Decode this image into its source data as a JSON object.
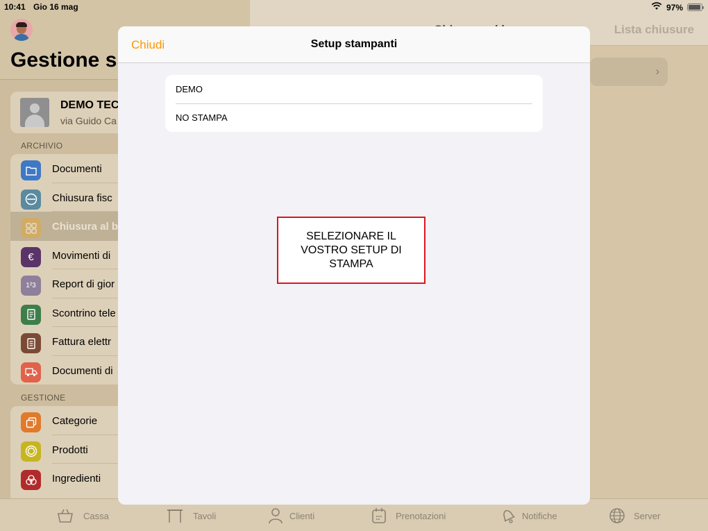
{
  "status_bar": {
    "time": "10:41",
    "date": "Gio 16 mag",
    "battery": "97%",
    "battery_level": 0.97
  },
  "master": {
    "title": "Gestione s",
    "profile": {
      "name": "DEMO TEC",
      "address": "via Guido Ca"
    },
    "sections": [
      {
        "header": "ARCHIVIO",
        "items": [
          {
            "label": "Documenti",
            "icon": "folder-icon",
            "color": "#3f78c5"
          },
          {
            "label": "Chiusura fisc",
            "icon": "minus-circle-icon",
            "color": "#5a8aa0"
          },
          {
            "label": "Chiusura al b",
            "icon": "grid-icon",
            "color": "#e3a93e",
            "selected": true
          },
          {
            "label": "Movimenti di",
            "icon": "euro-icon",
            "color": "#5a3468"
          },
          {
            "label": "Report di gior",
            "icon": "numbers-icon",
            "color": "#8e7f9a"
          },
          {
            "label": "Scontrino tele",
            "icon": "receipt-icon",
            "color": "#3f7d4b"
          },
          {
            "label": "Fattura elettr",
            "icon": "invoice-icon",
            "color": "#7b4a35"
          },
          {
            "label": "Documenti di",
            "icon": "truck-icon",
            "color": "#e0624a"
          }
        ]
      },
      {
        "header": "GESTIONE",
        "items": [
          {
            "label": "Categorie",
            "icon": "copy-icon",
            "color": "#e07a2c"
          },
          {
            "label": "Prodotti",
            "icon": "circle-icon",
            "color": "#c6b520"
          },
          {
            "label": "Ingredienti",
            "icon": "rings-icon",
            "color": "#b22b2b"
          }
        ]
      }
    ]
  },
  "detail": {
    "title_partial": "Chiusura al bar",
    "lista_button": "Lista chiusure"
  },
  "modal": {
    "close_label": "Chiudi",
    "title": "Setup stampanti",
    "printers": [
      "DEMO",
      "NO STAMPA"
    ],
    "instructions": "SELEZIONARE IL VOSTRO SETUP DI STAMPA",
    "accent_color": "#ff9500",
    "highlight_color": "#e1121b"
  },
  "tabbar": {
    "tabs": [
      {
        "label": "Cassa",
        "icon": "basket-icon"
      },
      {
        "label": "Tavoli",
        "icon": "table-icon"
      },
      {
        "label": "Clienti",
        "icon": "person-icon"
      },
      {
        "label": "Prenotazioni",
        "icon": "calendar-icon"
      },
      {
        "label": "Notifiche",
        "icon": "bell-icon"
      },
      {
        "label": "Server",
        "icon": "globe-icon"
      }
    ]
  }
}
